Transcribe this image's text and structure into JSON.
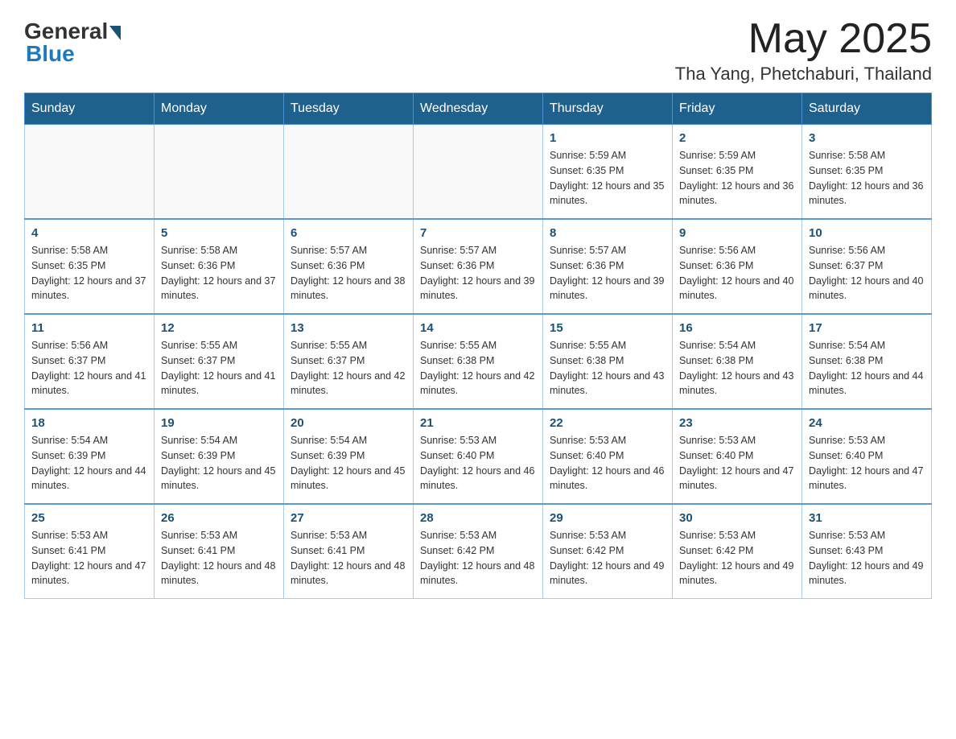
{
  "logo": {
    "general": "General",
    "blue": "Blue"
  },
  "title": {
    "month_year": "May 2025",
    "location": "Tha Yang, Phetchaburi, Thailand"
  },
  "days_of_week": [
    "Sunday",
    "Monday",
    "Tuesday",
    "Wednesday",
    "Thursday",
    "Friday",
    "Saturday"
  ],
  "weeks": [
    {
      "days": [
        {
          "number": "",
          "info": ""
        },
        {
          "number": "",
          "info": ""
        },
        {
          "number": "",
          "info": ""
        },
        {
          "number": "",
          "info": ""
        },
        {
          "number": "1",
          "info": "Sunrise: 5:59 AM\nSunset: 6:35 PM\nDaylight: 12 hours and 35 minutes."
        },
        {
          "number": "2",
          "info": "Sunrise: 5:59 AM\nSunset: 6:35 PM\nDaylight: 12 hours and 36 minutes."
        },
        {
          "number": "3",
          "info": "Sunrise: 5:58 AM\nSunset: 6:35 PM\nDaylight: 12 hours and 36 minutes."
        }
      ]
    },
    {
      "days": [
        {
          "number": "4",
          "info": "Sunrise: 5:58 AM\nSunset: 6:35 PM\nDaylight: 12 hours and 37 minutes."
        },
        {
          "number": "5",
          "info": "Sunrise: 5:58 AM\nSunset: 6:36 PM\nDaylight: 12 hours and 37 minutes."
        },
        {
          "number": "6",
          "info": "Sunrise: 5:57 AM\nSunset: 6:36 PM\nDaylight: 12 hours and 38 minutes."
        },
        {
          "number": "7",
          "info": "Sunrise: 5:57 AM\nSunset: 6:36 PM\nDaylight: 12 hours and 39 minutes."
        },
        {
          "number": "8",
          "info": "Sunrise: 5:57 AM\nSunset: 6:36 PM\nDaylight: 12 hours and 39 minutes."
        },
        {
          "number": "9",
          "info": "Sunrise: 5:56 AM\nSunset: 6:36 PM\nDaylight: 12 hours and 40 minutes."
        },
        {
          "number": "10",
          "info": "Sunrise: 5:56 AM\nSunset: 6:37 PM\nDaylight: 12 hours and 40 minutes."
        }
      ]
    },
    {
      "days": [
        {
          "number": "11",
          "info": "Sunrise: 5:56 AM\nSunset: 6:37 PM\nDaylight: 12 hours and 41 minutes."
        },
        {
          "number": "12",
          "info": "Sunrise: 5:55 AM\nSunset: 6:37 PM\nDaylight: 12 hours and 41 minutes."
        },
        {
          "number": "13",
          "info": "Sunrise: 5:55 AM\nSunset: 6:37 PM\nDaylight: 12 hours and 42 minutes."
        },
        {
          "number": "14",
          "info": "Sunrise: 5:55 AM\nSunset: 6:38 PM\nDaylight: 12 hours and 42 minutes."
        },
        {
          "number": "15",
          "info": "Sunrise: 5:55 AM\nSunset: 6:38 PM\nDaylight: 12 hours and 43 minutes."
        },
        {
          "number": "16",
          "info": "Sunrise: 5:54 AM\nSunset: 6:38 PM\nDaylight: 12 hours and 43 minutes."
        },
        {
          "number": "17",
          "info": "Sunrise: 5:54 AM\nSunset: 6:38 PM\nDaylight: 12 hours and 44 minutes."
        }
      ]
    },
    {
      "days": [
        {
          "number": "18",
          "info": "Sunrise: 5:54 AM\nSunset: 6:39 PM\nDaylight: 12 hours and 44 minutes."
        },
        {
          "number": "19",
          "info": "Sunrise: 5:54 AM\nSunset: 6:39 PM\nDaylight: 12 hours and 45 minutes."
        },
        {
          "number": "20",
          "info": "Sunrise: 5:54 AM\nSunset: 6:39 PM\nDaylight: 12 hours and 45 minutes."
        },
        {
          "number": "21",
          "info": "Sunrise: 5:53 AM\nSunset: 6:40 PM\nDaylight: 12 hours and 46 minutes."
        },
        {
          "number": "22",
          "info": "Sunrise: 5:53 AM\nSunset: 6:40 PM\nDaylight: 12 hours and 46 minutes."
        },
        {
          "number": "23",
          "info": "Sunrise: 5:53 AM\nSunset: 6:40 PM\nDaylight: 12 hours and 47 minutes."
        },
        {
          "number": "24",
          "info": "Sunrise: 5:53 AM\nSunset: 6:40 PM\nDaylight: 12 hours and 47 minutes."
        }
      ]
    },
    {
      "days": [
        {
          "number": "25",
          "info": "Sunrise: 5:53 AM\nSunset: 6:41 PM\nDaylight: 12 hours and 47 minutes."
        },
        {
          "number": "26",
          "info": "Sunrise: 5:53 AM\nSunset: 6:41 PM\nDaylight: 12 hours and 48 minutes."
        },
        {
          "number": "27",
          "info": "Sunrise: 5:53 AM\nSunset: 6:41 PM\nDaylight: 12 hours and 48 minutes."
        },
        {
          "number": "28",
          "info": "Sunrise: 5:53 AM\nSunset: 6:42 PM\nDaylight: 12 hours and 48 minutes."
        },
        {
          "number": "29",
          "info": "Sunrise: 5:53 AM\nSunset: 6:42 PM\nDaylight: 12 hours and 49 minutes."
        },
        {
          "number": "30",
          "info": "Sunrise: 5:53 AM\nSunset: 6:42 PM\nDaylight: 12 hours and 49 minutes."
        },
        {
          "number": "31",
          "info": "Sunrise: 5:53 AM\nSunset: 6:43 PM\nDaylight: 12 hours and 49 minutes."
        }
      ]
    }
  ]
}
